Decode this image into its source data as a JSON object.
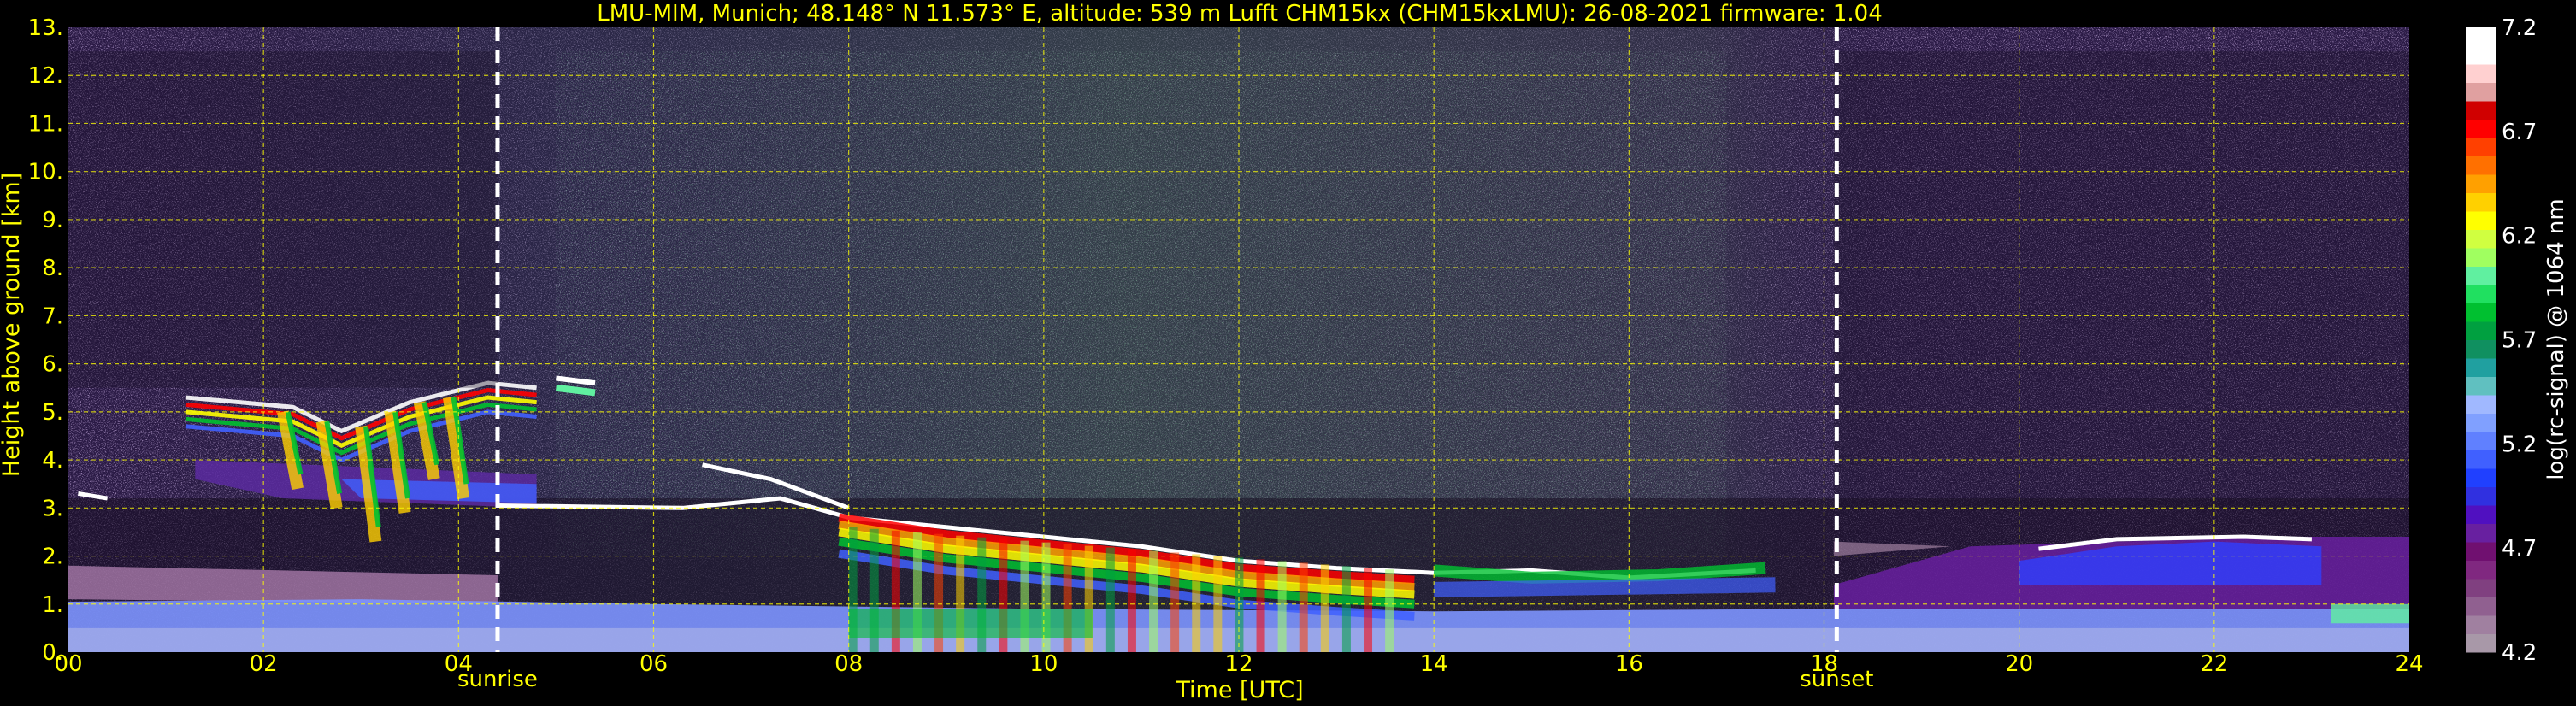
{
  "chart_data": {
    "type": "heatmap",
    "title": "LMU-MIM, Munich; 48.148° N 11.573° E, altitude: 539 m    Lufft CHM15kx (CHM15kxLMU): 26-08-2021    firmware: 1.04",
    "xlabel": "Time [UTC]",
    "ylabel": "Height above ground [km]",
    "xlim": [
      0,
      24
    ],
    "ylim": [
      0,
      13
    ],
    "x_ticks": [
      "00",
      "02",
      "04",
      "06",
      "08",
      "10",
      "12",
      "14",
      "16",
      "18",
      "20",
      "22",
      "24"
    ],
    "y_ticks": [
      "0.",
      "1.",
      "2.",
      "3.",
      "4.",
      "5.",
      "6.",
      "7.",
      "8.",
      "9.",
      "10.",
      "11.",
      "12.",
      "13."
    ],
    "grid": true,
    "markers": [
      {
        "label": "sunrise",
        "x": 4.4
      },
      {
        "label": "sunset",
        "x": 18.13
      }
    ],
    "colorbar": {
      "label": "log(rc-signal) @ 1064 nm",
      "range": [
        4.2,
        7.2
      ],
      "ticks": [
        "4.2",
        "4.7",
        "5.2",
        "5.7",
        "6.2",
        "6.7",
        "7.2"
      ],
      "colors": [
        "#a898a8",
        "#a080a0",
        "#906090",
        "#804080",
        "#802880",
        "#701070",
        "#6820a0",
        "#5010c0",
        "#3030e0",
        "#2040ff",
        "#4060ff",
        "#6080ff",
        "#80a0ff",
        "#a0b8ff",
        "#60c0c0",
        "#20a0a0",
        "#109060",
        "#00a040",
        "#00c030",
        "#20e060",
        "#60f0a0",
        "#a0ff60",
        "#d0ff40",
        "#ffff00",
        "#ffd000",
        "#ffa000",
        "#ff7000",
        "#ff4000",
        "#ff0000",
        "#d00000",
        "#e0a0a0",
        "#ffd0d0",
        "#ffffff",
        "#ffffff"
      ]
    },
    "features": {
      "upper_noise_color": "#7060a0",
      "boundary_layer_color": "#6080ff",
      "cloud_base_color": "#ffffff"
    }
  }
}
